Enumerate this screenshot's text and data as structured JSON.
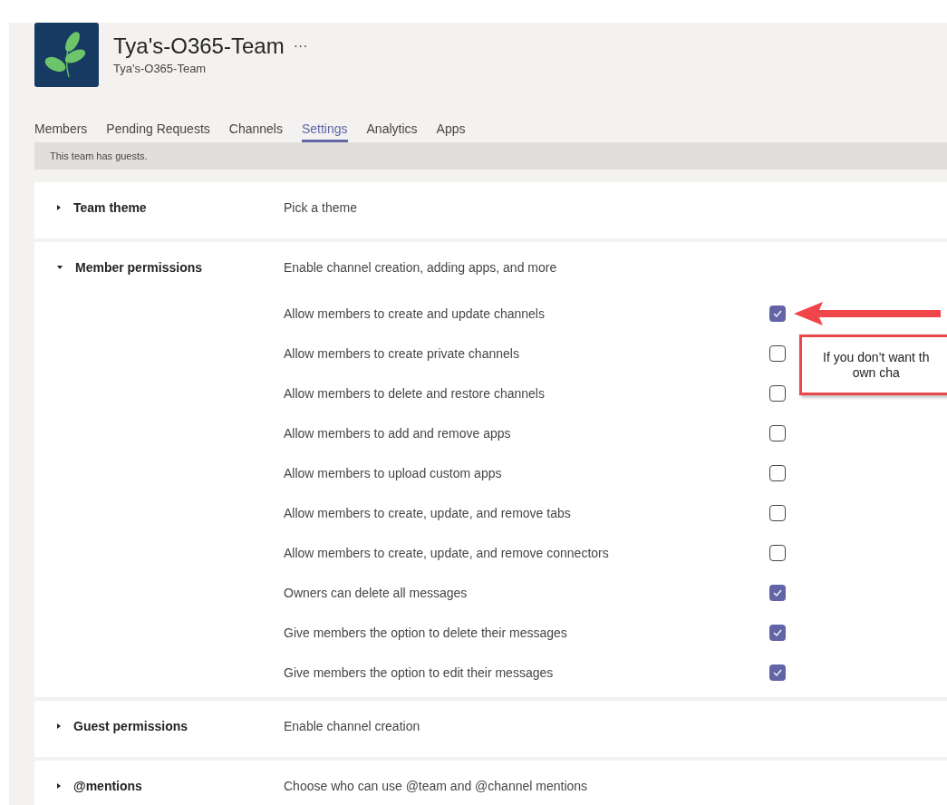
{
  "team": {
    "name": "Tya's-O365-Team",
    "more": "···",
    "subtitle": "Tya's-O365-Team"
  },
  "tabs": [
    {
      "label": "Members",
      "selected": false
    },
    {
      "label": "Pending Requests",
      "selected": false
    },
    {
      "label": "Channels",
      "selected": false
    },
    {
      "label": "Settings",
      "selected": true
    },
    {
      "label": "Analytics",
      "selected": false
    },
    {
      "label": "Apps",
      "selected": false
    }
  ],
  "notice": "This team has guests.",
  "sections": [
    {
      "title": "Team theme",
      "description": "Pick a theme",
      "expanded": false
    },
    {
      "title": "Member permissions",
      "description": "Enable channel creation, adding apps, and more",
      "expanded": true,
      "options": [
        {
          "label": "Allow members to create and update channels",
          "checked": true
        },
        {
          "label": "Allow members to create private channels",
          "checked": false
        },
        {
          "label": "Allow members to delete and restore channels",
          "checked": false
        },
        {
          "label": "Allow members to add and remove apps",
          "checked": false
        },
        {
          "label": "Allow members to upload custom apps",
          "checked": false
        },
        {
          "label": "Allow members to create, update, and remove tabs",
          "checked": false
        },
        {
          "label": "Allow members to create, update, and remove connectors",
          "checked": false
        },
        {
          "label": "Owners can delete all messages",
          "checked": true
        },
        {
          "label": "Give members the option to delete their messages",
          "checked": true
        },
        {
          "label": "Give members the option to edit their messages",
          "checked": true
        }
      ]
    },
    {
      "title": "Guest permissions",
      "description": "Enable channel creation",
      "expanded": false
    },
    {
      "title": "@mentions",
      "description": "Choose who can use @team and @channel mentions",
      "expanded": false
    }
  ],
  "callout": {
    "lines": [
      "If you don’t want th",
      "own cha"
    ]
  }
}
